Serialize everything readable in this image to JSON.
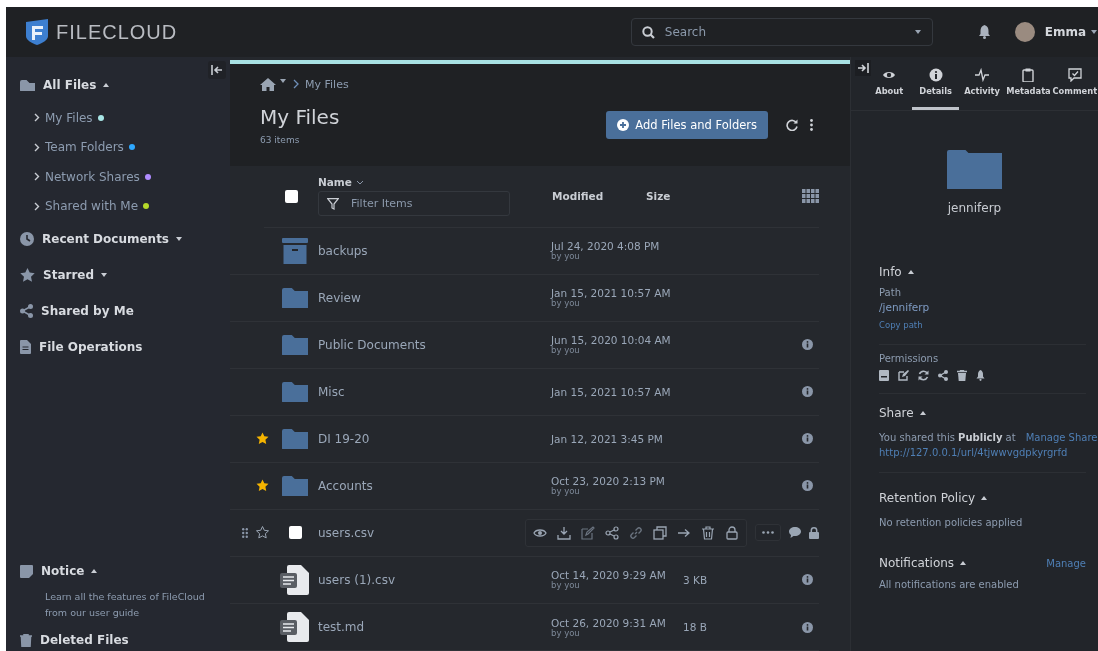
{
  "header": {
    "logo": "FILECLOUD",
    "search": {
      "placeholder": "Search"
    },
    "user": "Emma"
  },
  "sidebar": {
    "items": [
      {
        "label": "All Files",
        "expanded": true,
        "children": [
          {
            "label": "My Files",
            "color": "#a8e6e6"
          },
          {
            "label": "Team Folders",
            "color": "#2ea8ff"
          },
          {
            "label": "Network Shares",
            "color": "#b08cff"
          },
          {
            "label": "Shared with Me",
            "color": "#b5d92a"
          }
        ]
      },
      {
        "label": "Recent Documents",
        "expanded": false
      },
      {
        "label": "Starred",
        "expanded": false
      },
      {
        "label": "Shared by Me"
      },
      {
        "label": "File Operations"
      }
    ],
    "notice": {
      "title": "Notice",
      "expanded": true,
      "text": "Learn all the features of FileCloud from our user guide"
    },
    "deleted": "Deleted Files"
  },
  "main": {
    "progress": {
      "level": 1
    },
    "breadcrumb": "My Files",
    "title": "My Files",
    "count": "63 items",
    "add_button": "Add Files and Folders",
    "columns": {
      "name": "Name",
      "filter": {
        "placeholder": "Filter Items"
      },
      "modified": "Modified",
      "size": "Size"
    },
    "select_all": {
      "checked": false
    },
    "rows": [
      {
        "kind": "archive",
        "name": "backups",
        "modified": "Jul 24, 2020 4:08 PM",
        "by": "by you",
        "starred": false,
        "info": false,
        "hovered": false
      },
      {
        "kind": "folder",
        "name": "Review",
        "modified": "Jan 15, 2021 10:57 AM",
        "by": "by you",
        "starred": false,
        "info": false,
        "hovered": false
      },
      {
        "kind": "folder",
        "name": "Public Documents",
        "modified": "Jun 15, 2020 10:04 AM",
        "by": "by you",
        "starred": false,
        "info": true,
        "hovered": false
      },
      {
        "kind": "folder",
        "name": "Misc",
        "modified": "Jan 15, 2021 10:57 AM",
        "starred": false,
        "info": true,
        "hovered": false
      },
      {
        "kind": "folder",
        "name": "DI 19-20",
        "modified": "Jan 12, 2021 3:45 PM",
        "starred": true,
        "info": true,
        "hovered": false
      },
      {
        "kind": "folder",
        "name": "Accounts",
        "modified": "Oct 23, 2020 2:13 PM",
        "by": "by you",
        "starred": true,
        "info": true,
        "hovered": false
      },
      {
        "name": "users.csv",
        "starred": false,
        "hovered": true,
        "checked": false
      },
      {
        "kind": "document",
        "name": "users (1).csv",
        "modified": "Oct 14, 2020 9:29 AM",
        "by": "by you",
        "size": "3 KB",
        "starred": false,
        "info": true,
        "hovered": false
      },
      {
        "kind": "document",
        "name": "test.md",
        "modified": "Oct 26, 2020 9:31 AM",
        "by": "by you",
        "size": "18 B",
        "starred": false,
        "info": true,
        "hovered": false
      }
    ]
  },
  "details": {
    "tabs": [
      {
        "label": "About",
        "selected": false
      },
      {
        "label": "Details",
        "selected": true
      },
      {
        "label": "Activity",
        "selected": false
      },
      {
        "label": "Metadata",
        "selected": false
      },
      {
        "label": "Comment",
        "selected": false
      }
    ],
    "folder": "jenniferp",
    "info": {
      "title": "Info",
      "expanded": true,
      "path_label": "Path",
      "path": "/jenniferp",
      "copy": "Copy path",
      "permissions_label": "Permissions"
    },
    "share": {
      "title": "Share",
      "expanded": true,
      "text": "You shared this **Publicly** at",
      "manage": "Manage Share",
      "url": "http://127.0.0.1/url/4tjwwvgdpkyrgrfd"
    },
    "retention": {
      "title": "Retention Policy",
      "expanded": true,
      "text": "No retention policies applied"
    },
    "notifications": {
      "title": "Notifications",
      "expanded": true,
      "manage": "Manage",
      "text": "All notifications are enabled"
    }
  }
}
